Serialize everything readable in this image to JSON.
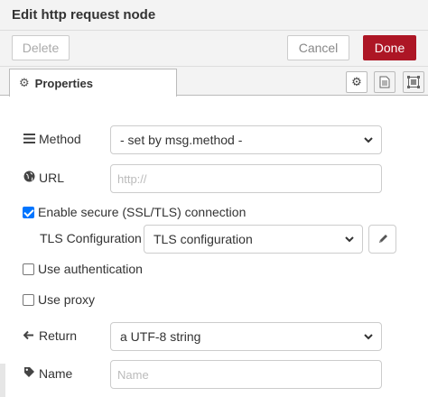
{
  "header": {
    "title": "Edit http request node"
  },
  "toolbar": {
    "delete_label": "Delete",
    "cancel_label": "Cancel",
    "done_label": "Done"
  },
  "tabs": {
    "properties_label": "Properties"
  },
  "form": {
    "method": {
      "label": "Method",
      "value": "- set by msg.method -"
    },
    "url": {
      "label": "URL",
      "placeholder": "http://"
    },
    "secure": {
      "label": "Enable secure (SSL/TLS) connection",
      "checked": true
    },
    "tls": {
      "label": "TLS Configuration",
      "value": "TLS configuration"
    },
    "auth": {
      "label": "Use authentication",
      "checked": false
    },
    "proxy": {
      "label": "Use proxy",
      "checked": false
    },
    "return": {
      "label": "Return",
      "value": "a UTF-8 string"
    },
    "name": {
      "label": "Name",
      "placeholder": "Name"
    }
  },
  "colors": {
    "done": "#ad1625",
    "checkbox_checked": "#0075ff"
  }
}
